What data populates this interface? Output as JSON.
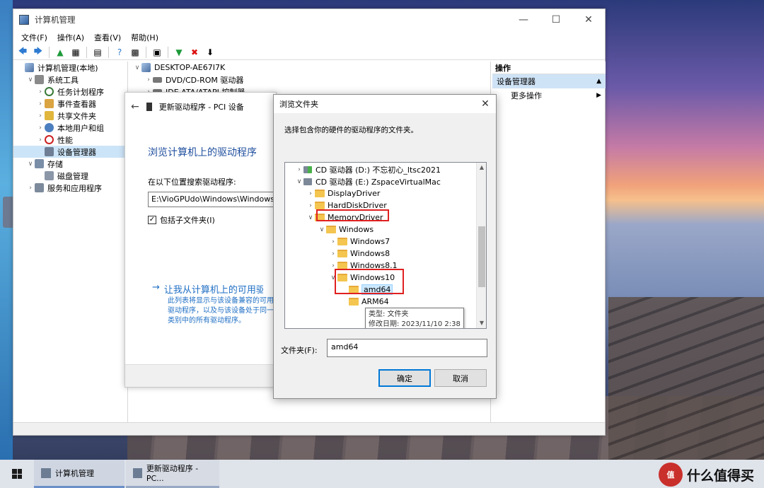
{
  "mmc": {
    "title": "计算机管理",
    "menu": [
      "文件(F)",
      "操作(A)",
      "查看(V)",
      "帮助(H)"
    ],
    "tree": [
      {
        "label": "计算机管理(本地)",
        "indent": 0,
        "chev": "",
        "icon": "comp"
      },
      {
        "label": "系统工具",
        "indent": 1,
        "chev": "v",
        "icon": "tool"
      },
      {
        "label": "任务计划程序",
        "indent": 2,
        "chev": ">",
        "icon": "clock"
      },
      {
        "label": "事件查看器",
        "indent": 2,
        "chev": ">",
        "icon": "event"
      },
      {
        "label": "共享文件夹",
        "indent": 2,
        "chev": ">",
        "icon": "share"
      },
      {
        "label": "本地用户和组",
        "indent": 2,
        "chev": ">",
        "icon": "users"
      },
      {
        "label": "性能",
        "indent": 2,
        "chev": ">",
        "icon": "perf"
      },
      {
        "label": "设备管理器",
        "indent": 2,
        "chev": "",
        "icon": "dev",
        "selected": true
      },
      {
        "label": "存储",
        "indent": 1,
        "chev": "v",
        "icon": "store"
      },
      {
        "label": "磁盘管理",
        "indent": 2,
        "chev": "",
        "icon": "disk"
      },
      {
        "label": "服务和应用程序",
        "indent": 1,
        "chev": ">",
        "icon": "svc"
      }
    ],
    "device_tree": [
      {
        "label": "DESKTOP-AE67I7K",
        "chev": "v"
      },
      {
        "label": "DVD/CD-ROM 驱动器",
        "chev": ">"
      },
      {
        "label": "IDE ATA/ATAPI 控制器",
        "chev": ">"
      }
    ],
    "ops_title": "操作",
    "ops_selected": "设备管理器",
    "ops_more": "更多操作"
  },
  "update_driver": {
    "header": "更新驱动程序 - PCI 设备",
    "heading": "浏览计算机上的驱动程序",
    "search_label": "在以下位置搜索驱动程序:",
    "path_value": "E:\\VioGPUdo\\Windows\\Windows10",
    "include_subfolders": "包括子文件夹(I)",
    "link_text": "让我从计算机上的可用驱",
    "link_desc": "此列表将显示与该设备兼容的可用驱动程序，以及与该设备处于同一类别中的所有驱动程序。"
  },
  "browse_folder": {
    "title": "浏览文件夹",
    "description": "选择包含你的硬件的驱动程序的文件夹。",
    "tree": [
      {
        "label": "CD 驱动器 (D:) 不忘初心_ltsc2021",
        "level": 1,
        "chev": ">",
        "icon": "cd-green"
      },
      {
        "label": "CD 驱动器 (E:) ZspaceVirtualMac",
        "level": 1,
        "chev": "v",
        "icon": "cd"
      },
      {
        "label": "DisplayDriver",
        "level": 2,
        "chev": ">",
        "icon": "folder"
      },
      {
        "label": "HardDiskDriver",
        "level": 2,
        "chev": ">",
        "icon": "folder"
      },
      {
        "label": "MemoryDriver",
        "level": 2,
        "chev": "v",
        "icon": "folder",
        "highlight": true
      },
      {
        "label": "Windows",
        "level": 3,
        "chev": "v",
        "icon": "folder"
      },
      {
        "label": "Windows7",
        "level": 4,
        "chev": ">",
        "icon": "folder"
      },
      {
        "label": "Windows8",
        "level": 4,
        "chev": ">",
        "icon": "folder"
      },
      {
        "label": "Windows8.1",
        "level": 4,
        "chev": ">",
        "icon": "folder"
      },
      {
        "label": "Windows10",
        "level": 4,
        "chev": "v",
        "icon": "folder",
        "highlight": true
      },
      {
        "label": "amd64",
        "level": 5,
        "chev": "",
        "icon": "folder",
        "selected": true,
        "highlight": true
      },
      {
        "label": "ARM64",
        "level": 5,
        "chev": "",
        "icon": "folder"
      }
    ],
    "tooltip_type": "类型: 文件夹",
    "tooltip_date": "修改日期: 2023/11/10 2:38",
    "folder_label": "文件夹(F):",
    "folder_value": "amd64",
    "ok": "确定",
    "cancel": "取消"
  },
  "taskbar": {
    "items": [
      "计算机管理",
      "更新驱动程序 - PC..."
    ],
    "watermark": "什么值得买",
    "watermark_logo": "值"
  }
}
